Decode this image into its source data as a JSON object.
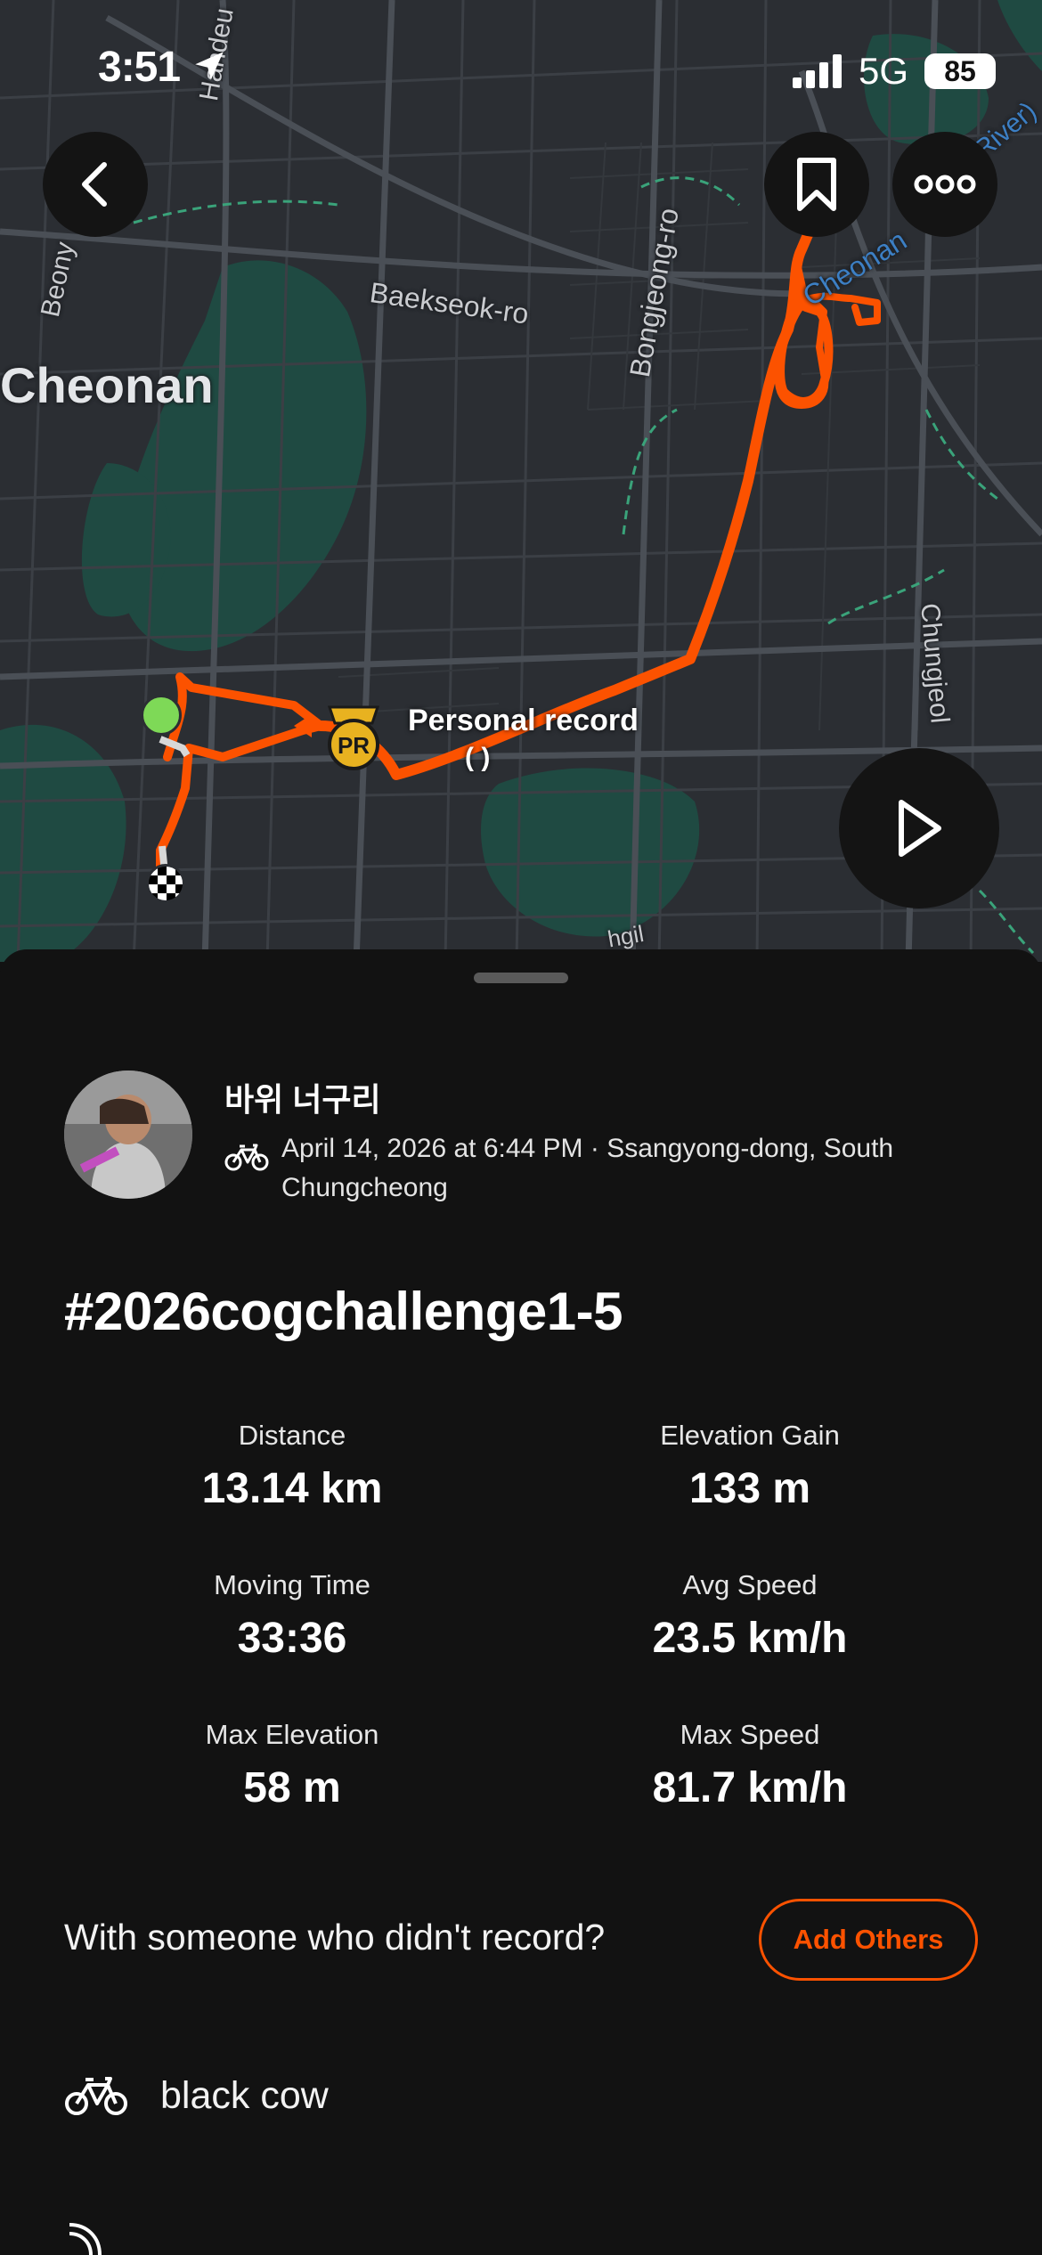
{
  "status_bar": {
    "time": "3:51",
    "network": "5G",
    "battery": "85"
  },
  "map": {
    "labels": {
      "city": "Cheonan",
      "baekseok": "Baekseok-ro",
      "bongjeong": "Bongjeong-ro",
      "chungjeol": "Chungjeol",
      "beonyeong": "Beony",
      "handeul": "Handeu",
      "river": "Cheonan",
      "river2": "(River)",
      "bottom": "hgil"
    },
    "personal_record": {
      "label": "Personal record",
      "sub": "(        )",
      "badge": "PR"
    },
    "icons": {
      "back": "chevron-left-icon",
      "save": "bookmark-icon",
      "more": "more-icon",
      "play": "play-icon"
    }
  },
  "activity": {
    "athlete_name": "바위 너구리",
    "meta": "April 14, 2026 at 6:44 PM · Ssangyong-dong, South Chungcheong",
    "title": "#2026cogchallenge1-5",
    "stats": [
      {
        "label": "Distance",
        "value": "13.14 km"
      },
      {
        "label": "Elevation Gain",
        "value": "133 m"
      },
      {
        "label": "Moving Time",
        "value": "33:36"
      },
      {
        "label": "Avg Speed",
        "value": "23.5 km/h"
      },
      {
        "label": "Max Elevation",
        "value": "58 m"
      },
      {
        "label": "Max Speed",
        "value": "81.7 km/h"
      }
    ],
    "others_prompt": "With someone who didn't record?",
    "add_others_label": "Add Others",
    "gear_name": "black cow"
  },
  "colors": {
    "accent": "#fc5200",
    "start_marker": "#7ed957",
    "pr_gold": "#e8b220",
    "sheet_bg": "#121212"
  }
}
